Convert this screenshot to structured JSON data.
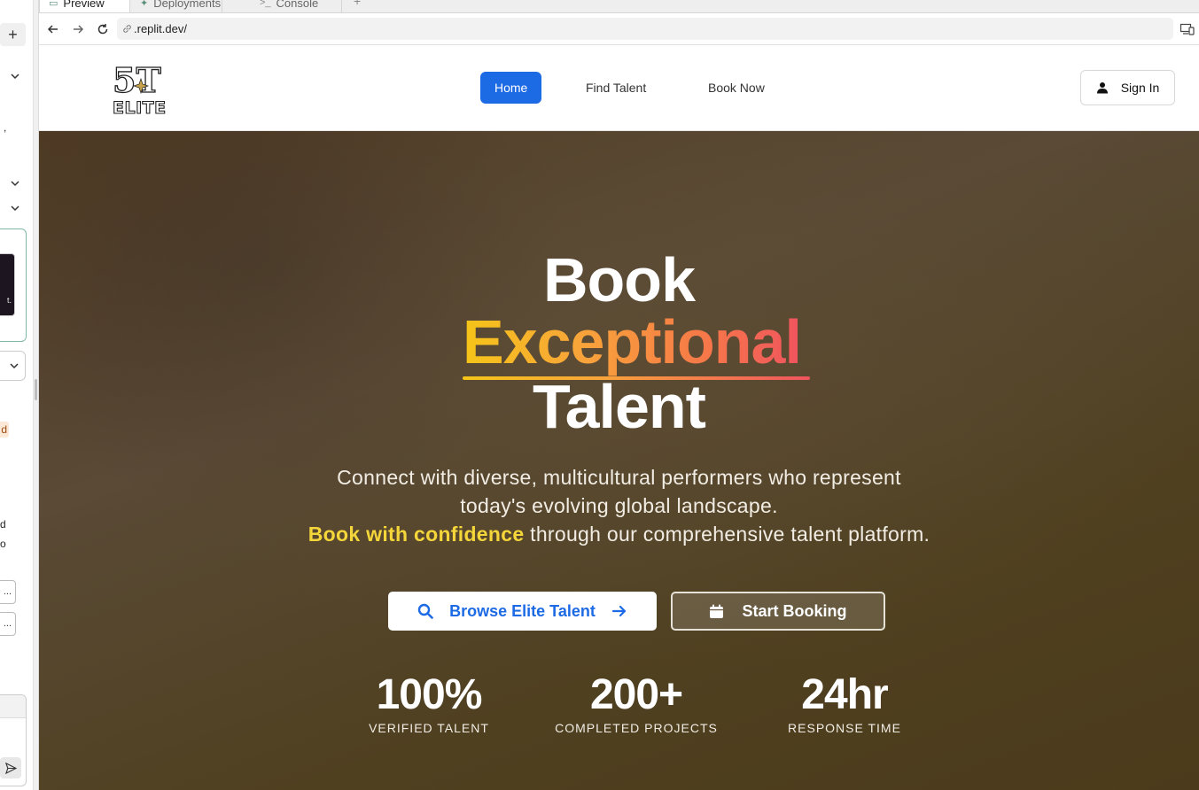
{
  "browser": {
    "tabs": [
      {
        "label": "Preview",
        "icon": "monitor-icon"
      },
      {
        "label": "Deployments",
        "icon": "deploy-icon"
      },
      {
        "label": "Console",
        "icon": "terminal-icon"
      }
    ],
    "add_tab": "+",
    "url": ".replit.dev/"
  },
  "sidebar": {
    "add": "+",
    "text_fragments": [
      "l ,",
      "d",
      "d",
      "o"
    ],
    "mini_buttons": [
      "...",
      "..."
    ],
    "thumb_text": "t."
  },
  "site": {
    "logo_text_top": "5T",
    "logo_text_bottom": "ELITE",
    "nav": [
      {
        "label": "Home",
        "active": true
      },
      {
        "label": "Find Talent",
        "active": false
      },
      {
        "label": "Book Now",
        "active": false
      }
    ],
    "sign_in": "Sign In"
  },
  "hero": {
    "title_line1": "Book",
    "title_line2": "Exceptional",
    "title_line3": "Talent",
    "subtitle_line1": "Connect with diverse, multicultural performers who represent",
    "subtitle_line2": "today's evolving global landscape.",
    "subtitle_highlight": "Book with confidence",
    "subtitle_line3_rest": " through our comprehensive talent platform.",
    "browse_button": "Browse Elite Talent",
    "booking_button": "Start Booking",
    "stats": [
      {
        "value": "100%",
        "label": "VERIFIED TALENT"
      },
      {
        "value": "200+",
        "label": "COMPLETED PROJECTS"
      },
      {
        "value": "24hr",
        "label": "RESPONSE TIME"
      }
    ]
  },
  "colors": {
    "primary": "#1d6ae5",
    "highlight": "#f5d63a",
    "gradient_start": "#f5c518",
    "gradient_end": "#f0545e"
  }
}
